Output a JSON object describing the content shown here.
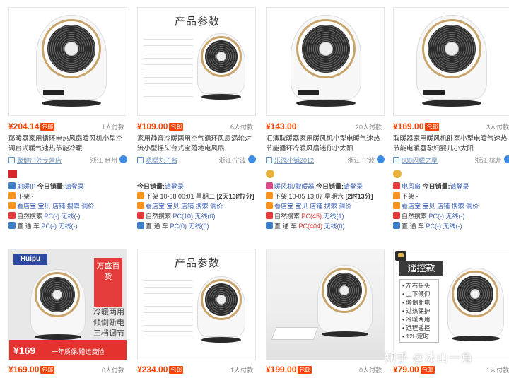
{
  "products": [
    {
      "price": "¥204.14",
      "shipping": "包邮",
      "paid_count": "1人付款",
      "title": "耶暖器家用循环电热风扇暖风机小型空调台式暖气速热节能冷暖",
      "shop": "聚健户外专营店",
      "location": "浙江 台州",
      "extra": [
        {
          "icon": "blue",
          "prefix": "耶暖IP",
          "middle": "今日销量:",
          "link": "请登录"
        },
        {
          "icon": "orange",
          "text": "下架 -"
        },
        {
          "icon": "orange",
          "parts": [
            "看店宝",
            "宝贝",
            "店铺",
            "搜索",
            "调价"
          ]
        },
        {
          "icon": "red",
          "text": "自然搜索:",
          "value": "PC(-)",
          "value2": "无线(-)"
        },
        {
          "icon": "blue",
          "text": "直 通 车:",
          "value": "PC(-)",
          "value2": "无线(-)"
        }
      ]
    },
    {
      "price": "¥109.00",
      "shipping": "包邮",
      "paid_count": "6人付款",
      "title": "家用静音冷暖两用空气循环风扇涡轮对流小型摇头台式宝落地电风扇",
      "shop": "嗯嗯丸子酱",
      "location": "浙江 宁波",
      "image_heading": "产品参数",
      "extra": [
        {
          "middle": "今日销量:",
          "link": "请登录"
        },
        {
          "icon": "orange",
          "text": "下架 10-08 00:01 星期二",
          "bold": "[2天13时7分]"
        },
        {
          "icon": "orange",
          "parts": [
            "看店宝",
            "宝贝",
            "店铺",
            "搜索",
            "调价"
          ]
        },
        {
          "icon": "red",
          "text": "自然搜索:",
          "value": "PC(10)",
          "value2": "无线(0)"
        },
        {
          "icon": "blue",
          "text": "直 通 车:",
          "value": "PC(0)",
          "value2": "无线(0)"
        }
      ]
    },
    {
      "price": "¥143.00",
      "shipping": "",
      "paid_count": "20人付款",
      "title": "汇演取暖器家用暖风机小型电暖气速热节能循环冷暖风扇迷你小太阳",
      "shop": "乐添小铺2012",
      "location": "浙江 宁波",
      "extra": [
        {
          "icon": "pink",
          "prefix": "暖风机/取暖器",
          "middle": "今日销量:",
          "link": "请登录"
        },
        {
          "icon": "orange",
          "text": "下架 10-05 13:07 星期六",
          "bold": "[2时13分]"
        },
        {
          "icon": "orange",
          "parts": [
            "看店宝",
            "宝贝",
            "店铺",
            "搜索",
            "调价"
          ]
        },
        {
          "icon": "red",
          "text": "自然搜索:",
          "value": "PC(45)",
          "value2": "无线(1)"
        },
        {
          "icon": "blue",
          "text": "直 通 车:",
          "value": "PC(404)",
          "value2": "无线(0)"
        }
      ]
    },
    {
      "price": "¥169.00",
      "shipping": "包邮",
      "paid_count": "3人付款",
      "title": "取暖器家用暖风机卧室小型电暖气速热节能电暖器孕妇婴儿小太阳",
      "shop": "888闪耀之星",
      "location": "浙江 杭州",
      "extra": [
        {
          "icon": "red",
          "prefix": "电风扇",
          "middle": "今日销量:",
          "link": "请登录"
        },
        {
          "icon": "orange",
          "text": "下架 -"
        },
        {
          "icon": "orange",
          "parts": [
            "看店宝",
            "宝贝",
            "店铺",
            "搜索",
            "调价"
          ]
        },
        {
          "icon": "red",
          "text": "自然搜索:",
          "value": "PC(-)",
          "value2": "无线(-)"
        },
        {
          "icon": "blue",
          "text": "直 通 车:",
          "value": "PC(-)",
          "value2": "无线(-)"
        }
      ]
    },
    {
      "price": "¥169.00",
      "shipping": "包邮",
      "paid_count": "0人付款",
      "promo": {
        "logo": "Huipu",
        "tag": "万盛百货",
        "text": "冷暖两用 倾倒断电 三档调节",
        "price": "¥169",
        "slogan": "一年质保/赠运费险"
      }
    },
    {
      "price": "¥234.00",
      "shipping": "包邮",
      "paid_count": "1人付款",
      "image_heading": "产品参数"
    },
    {
      "price": "¥199.00",
      "shipping": "包邮",
      "paid_count": "0人付款"
    },
    {
      "price": "¥79.00",
      "shipping": "包邮",
      "paid_count": "1人付款",
      "remote": {
        "tag": "遥控款",
        "features": [
          "• 左右摇头",
          "• 上下倾仰",
          "• 倾倒断电",
          "• 过热保护",
          "• 冷暖两用",
          "• 远程遥控",
          "• 12H定时"
        ]
      }
    }
  ],
  "watermark": "知乎 @冰山一角",
  "colors": {
    "price": "#ff4400",
    "link": "#3d63b9",
    "accent_red": "#e4302f"
  }
}
